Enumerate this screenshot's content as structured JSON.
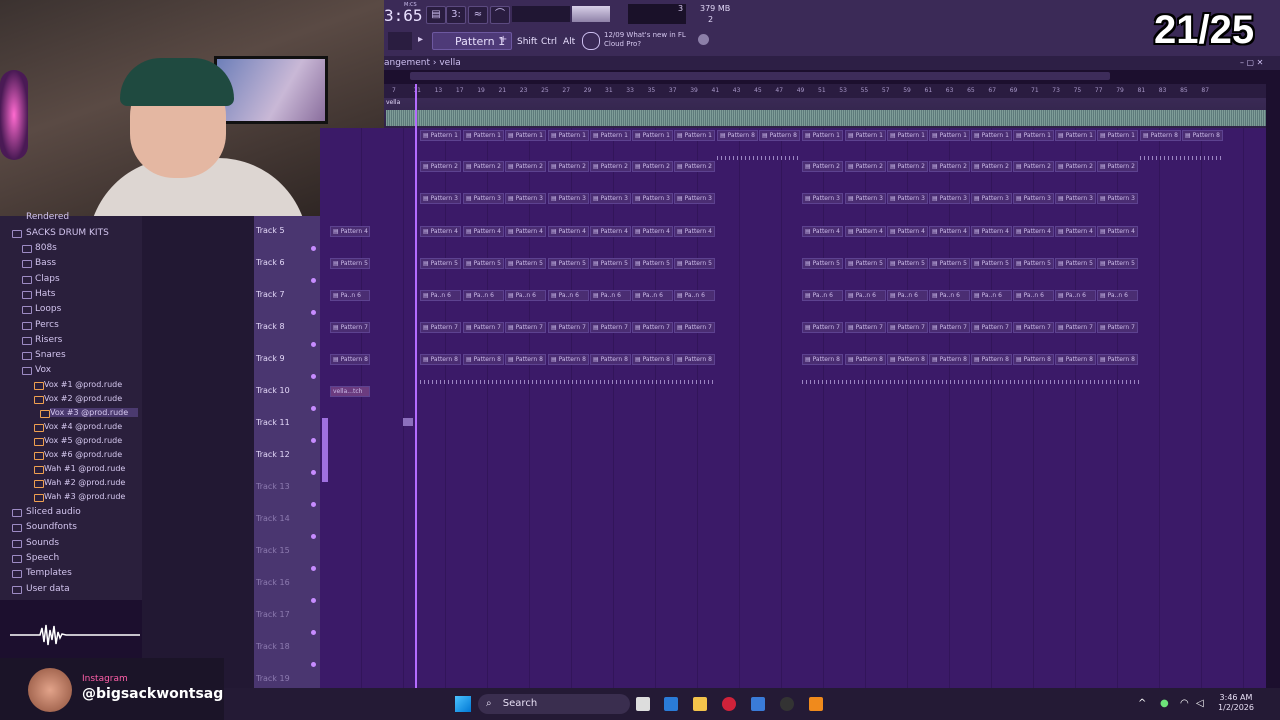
{
  "overlay": {
    "counter": "21/25"
  },
  "fl_toolbar": {
    "time": "3:65",
    "time_mode": "M:CS",
    "memory": "379 MB",
    "mem_small": "3",
    "mem_small2": "2",
    "pattern": "Pattern 1",
    "keys": [
      "Shift",
      "Ctrl",
      "Alt"
    ],
    "news": "12/09  What's new in FL Cloud Pro?"
  },
  "arrangement": {
    "breadcrumb": "angement",
    "name": "vella",
    "ruler_marks": [
      "7",
      "11",
      "13",
      "17",
      "19",
      "21",
      "23",
      "25",
      "27",
      "29",
      "31",
      "33",
      "35",
      "37",
      "39",
      "41",
      "43",
      "45",
      "47",
      "49",
      "51",
      "53",
      "55",
      "57",
      "59",
      "61",
      "63",
      "65",
      "67",
      "69",
      "71",
      "73",
      "75",
      "77",
      "79",
      "81",
      "83",
      "85",
      "87"
    ],
    "audio_clip_label": "vella"
  },
  "tracks": [
    {
      "label": "Track 5",
      "clip": "Pattern 4",
      "short": "Pattern 4"
    },
    {
      "label": "Track 6",
      "clip": "Pattern 5",
      "short": "Pattern 5"
    },
    {
      "label": "Track 7",
      "clip": "Pa..n 6",
      "short": "Pa..n 6"
    },
    {
      "label": "Track 8",
      "clip": "Pattern 7",
      "short": "Pattern 7"
    },
    {
      "label": "Track 9",
      "clip": "Pattern 8",
      "short": "Pattern 8"
    },
    {
      "label": "Track 10",
      "clip": "vella...tch",
      "short": "vella...tch"
    },
    {
      "label": "Track 11",
      "clip": "",
      "short": ""
    },
    {
      "label": "Track 12",
      "clip": "",
      "short": ""
    },
    {
      "label": "Track 13",
      "clip": "",
      "short": ""
    },
    {
      "label": "Track 14",
      "clip": "",
      "short": ""
    },
    {
      "label": "Track 15",
      "clip": "",
      "short": ""
    },
    {
      "label": "Track 16",
      "clip": "",
      "short": ""
    },
    {
      "label": "Track 17",
      "clip": "",
      "short": ""
    },
    {
      "label": "Track 18",
      "clip": "",
      "short": ""
    },
    {
      "label": "Track 19",
      "clip": "",
      "short": ""
    }
  ],
  "top_rows": [
    "Pattern 1",
    "Pattern 2",
    "Pattern 3"
  ],
  "browser": {
    "items": [
      {
        "label": "Rendered",
        "type": "partial"
      },
      {
        "label": "SACKS DRUM KITS",
        "type": "folder"
      },
      {
        "label": "808s",
        "type": "sub"
      },
      {
        "label": "Bass",
        "type": "sub"
      },
      {
        "label": "Claps",
        "type": "sub"
      },
      {
        "label": "Hats",
        "type": "sub"
      },
      {
        "label": "Loops",
        "type": "sub"
      },
      {
        "label": "Percs",
        "type": "sub"
      },
      {
        "label": "Risers",
        "type": "sub"
      },
      {
        "label": "Snares",
        "type": "sub"
      },
      {
        "label": "Vox",
        "type": "sub"
      }
    ],
    "vox_files": [
      "Vox #1 @prod.rude",
      "Vox #2 @prod.rude",
      "Vox #3 @prod.rude",
      "Vox #4 @prod.rude",
      "Vox #5 @prod.rude",
      "Vox #6 @prod.rude",
      "Wah #1 @prod.rude",
      "Wah #2 @prod.rude",
      "Wah #3 @prod.rude"
    ],
    "selected_file": "Vox #3 @prod.rude",
    "bottom_items": [
      "Sliced audio",
      "Soundfonts",
      "Sounds",
      "Speech",
      "Templates",
      "User data"
    ]
  },
  "instagram": {
    "label": "Instagram",
    "handle": "@bigsackwontsag"
  },
  "taskbar": {
    "search": "Search",
    "time": "3:46 AM",
    "date": "1/2/2026"
  }
}
